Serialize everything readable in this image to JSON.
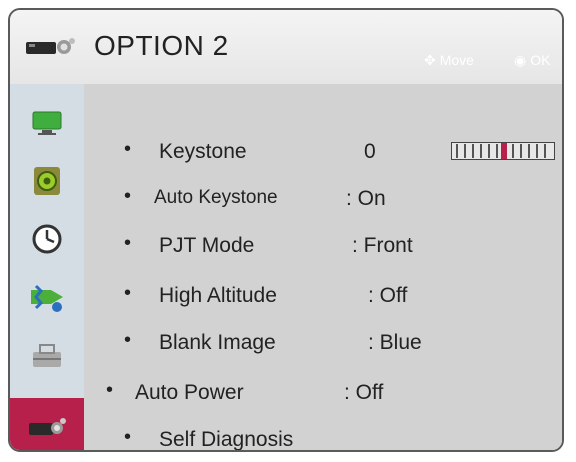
{
  "header": {
    "title": "OPTION 2",
    "move_hint": "Move",
    "ok_hint": "OK"
  },
  "sidebar": {
    "tabs": [
      {
        "icon": "picture-icon",
        "selected": false
      },
      {
        "icon": "audio-icon",
        "selected": false
      },
      {
        "icon": "time-icon",
        "selected": false
      },
      {
        "icon": "network-icon",
        "selected": false
      },
      {
        "icon": "option-icon",
        "selected": false
      },
      {
        "icon": "option2-icon",
        "selected": true
      }
    ]
  },
  "menu": {
    "items": [
      {
        "label": "Keystone",
        "value": "0"
      },
      {
        "label": "Auto Keystone",
        "value": ": On"
      },
      {
        "label": "PJT Mode",
        "value": ": Front"
      },
      {
        "label": "High Altitude",
        "value": ": Off"
      },
      {
        "label": "Blank Image",
        "value": ": Blue"
      },
      {
        "label": "Auto Power",
        "value": ": Off"
      },
      {
        "label": "Self Diagnosis",
        "value": ""
      }
    ],
    "keystone_slider": {
      "value": 0,
      "min": -20,
      "max": 20
    }
  },
  "colors": {
    "accent": "#b6204a",
    "sidebar_bg": "#d4dde4",
    "content_bg": "#d2d2d2"
  }
}
